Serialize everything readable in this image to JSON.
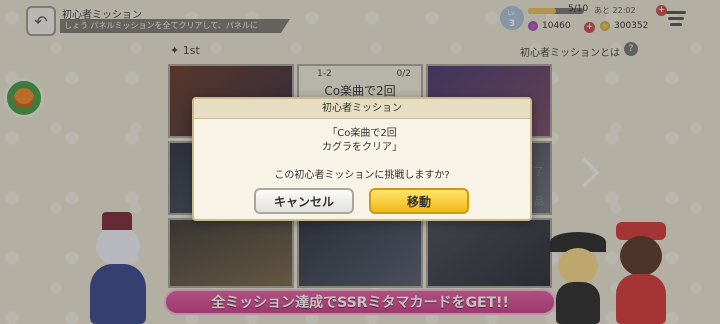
{
  "header": {
    "title": "初心者ミッション",
    "marquee": "しょう パネルミッションを全てクリアして、パネルに",
    "level_label": "Lv.",
    "level": "3",
    "stamina": "5/10",
    "stamina_fraction": 0.5,
    "time": "あと 22:02",
    "gems": "10460",
    "coins": "300352"
  },
  "page": {
    "tier": "1st",
    "info_link": "初心者ミッションとは"
  },
  "cards": {
    "center_tag": "1-2",
    "center_progress": "0/2",
    "center_title": "Co楽曲で2回",
    "right_edge_1": "了",
    "right_edge_2": "品"
  },
  "banner": {
    "text": "全ミッション達成でSSRミタマカードをGET!!"
  },
  "dialog": {
    "title": "初心者ミッション",
    "mission_line1": "「Co楽曲で2回",
    "mission_line2": "カグラをクリア」",
    "question": "この初心者ミッションに挑戦しますか?",
    "cancel_label": "キャンセル",
    "move_label": "移動"
  },
  "colors": {
    "accent_yellow": "#f1b817",
    "banner_pink": "#e75ea4"
  }
}
